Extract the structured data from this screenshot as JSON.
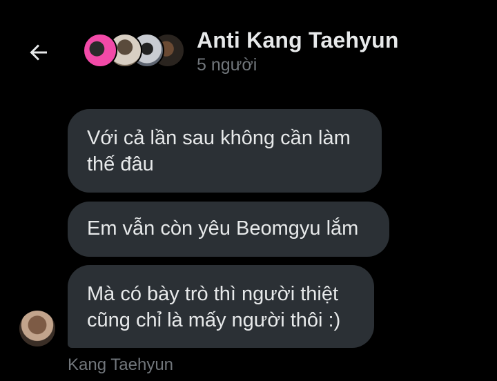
{
  "header": {
    "title": "Anti Kang Taehyun",
    "subtitle": "5 người",
    "back_icon": "arrow-left-icon",
    "member_avatar_count": 4
  },
  "messages": [
    {
      "lines": [
        "Với cả lần sau không cần làm",
        "thế đâu"
      ]
    },
    {
      "lines": [
        "Em vẫn còn yêu Beomgyu lắm"
      ]
    },
    {
      "lines": [
        "Mà có bày trò thì người thiệt",
        "cũng chỉ là mấy người thôi :)"
      ]
    }
  ],
  "sender": {
    "name": "Kang Taehyun"
  },
  "colors": {
    "background": "#000000",
    "bubble": "#2b3035",
    "text": "#e7e9ea",
    "muted": "#71767b"
  }
}
